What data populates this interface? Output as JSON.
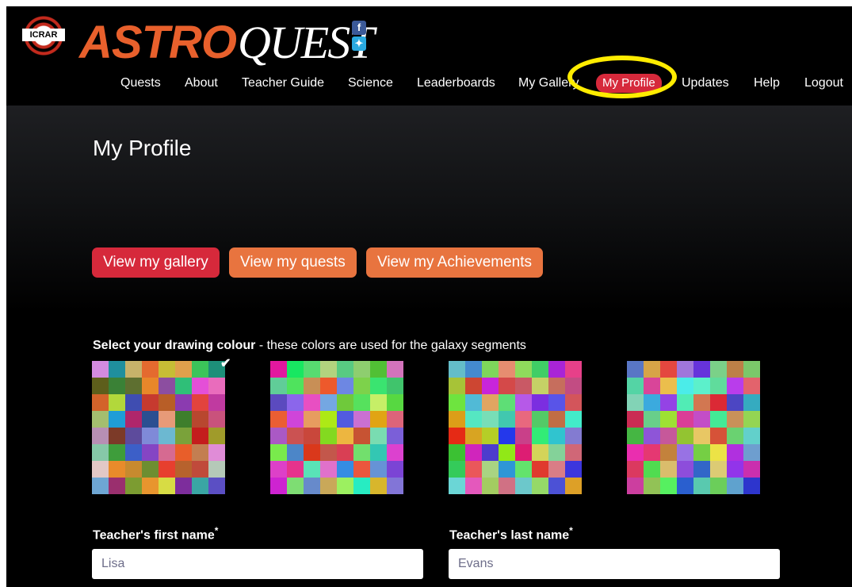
{
  "header": {
    "icrar_logo": "ICRAR",
    "logo_astro": "ASTRO",
    "logo_quest": "QUEST",
    "social": {
      "facebook_icon": "facebook-icon",
      "twitter_icon": "twitter-icon"
    }
  },
  "nav": {
    "items": [
      {
        "label": "Quests"
      },
      {
        "label": "About"
      },
      {
        "label": "Teacher Guide"
      },
      {
        "label": "Science"
      },
      {
        "label": "Leaderboards"
      },
      {
        "label": "My Gallery"
      },
      {
        "label": "My Profile",
        "active": true
      },
      {
        "label": "Updates"
      },
      {
        "label": "Help"
      },
      {
        "label": "Logout"
      }
    ]
  },
  "page": {
    "title": "My Profile",
    "buttons": {
      "gallery": "View my gallery",
      "quests": "View my quests",
      "achievements": "View my Achievements"
    },
    "colour_label_bold": "Select your drawing colour",
    "colour_label_rest": " - these colors are used for the galaxy segments",
    "palette_selected_index": 0
  },
  "form": {
    "first_name_label": "Teacher's first name",
    "first_name_value": "Lisa",
    "last_name_label": "Teacher's last name",
    "last_name_value": "Evans",
    "required_marker": "*"
  },
  "colors": {
    "accent_red": "#d6293b",
    "accent_orange": "#e8743f",
    "highlight": "#ffec00"
  }
}
